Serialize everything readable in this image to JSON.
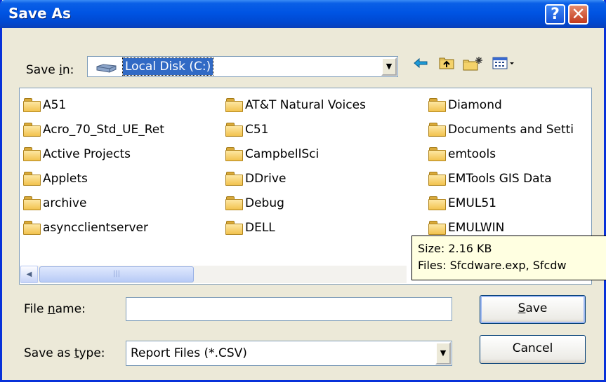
{
  "title": "Save As",
  "title_buttons": {
    "help": "?",
    "close": "✕"
  },
  "save_in": {
    "label_pre": "Save ",
    "label_key": "i",
    "label_post": "n:",
    "value": "Local Disk (C:)",
    "icon": "drive-icon"
  },
  "toolbar": {
    "back_icon": "back-arrow-icon",
    "up_icon": "up-folder-icon",
    "new_folder_icon": "new-folder-icon",
    "views_icon": "views-menu-icon"
  },
  "files": [
    "A51",
    "Acro_70_Std_UE_Ret",
    "Active Projects",
    "Applets",
    "archive",
    "asyncclientserver",
    "AT&T Natural Voices",
    "C51",
    "CampbellSci",
    "DDrive",
    "Debug",
    "DELL",
    "Diamond",
    "Documents and Setti",
    "emtools",
    "EMTools GIS Data",
    "EMUL51",
    "EMULWIN"
  ],
  "tooltip": {
    "line1": "Size: 2.16 KB",
    "line2": "Files: Sfcdware.exp, Sfcdw"
  },
  "file_name": {
    "label_pre": "File ",
    "label_key": "n",
    "label_post": "ame:",
    "value": ""
  },
  "save_as_type": {
    "label_pre": "Save as ",
    "label_key": "t",
    "label_post": "ype:",
    "value": "Report Files (*.CSV)"
  },
  "buttons": {
    "save_key": "S",
    "save_rest": "ave",
    "cancel": "Cancel"
  },
  "colors": {
    "title_bar": "#0054e3",
    "selection": "#316ac5",
    "tooltip_bg": "#ffffe1",
    "dialog_bg": "#ece9d8"
  }
}
